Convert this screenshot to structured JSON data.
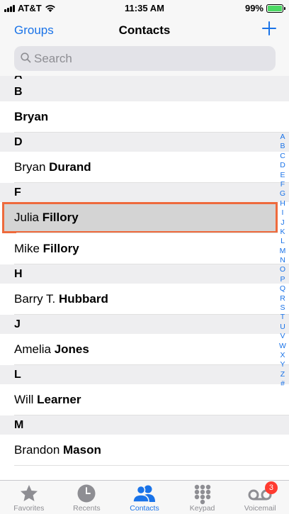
{
  "status": {
    "carrier": "AT&T",
    "time": "11:35 AM",
    "battery": "99%",
    "battery_level": 0.99
  },
  "nav": {
    "left": "Groups",
    "title": "Contacts"
  },
  "search": {
    "placeholder": "Search"
  },
  "sections": [
    {
      "letter": "A"
    },
    {
      "letter": "B",
      "contacts": [
        {
          "first": "",
          "last": "Bryan"
        }
      ]
    },
    {
      "letter": "D",
      "contacts": [
        {
          "first": "Bryan",
          "last": "Durand"
        }
      ]
    },
    {
      "letter": "F",
      "contacts": [
        {
          "first": "Julia",
          "last": "Fillory",
          "highlighted": true
        },
        {
          "first": "Mike",
          "last": "Fillory"
        }
      ]
    },
    {
      "letter": "H",
      "contacts": [
        {
          "first": "Barry T.",
          "last": "Hubbard"
        }
      ]
    },
    {
      "letter": "J",
      "contacts": [
        {
          "first": "Amelia",
          "last": "Jones"
        }
      ]
    },
    {
      "letter": "L",
      "contacts": [
        {
          "first": "Will",
          "last": "Learner"
        }
      ]
    },
    {
      "letter": "M",
      "contacts": [
        {
          "first": "Brandon",
          "last": "Mason"
        }
      ]
    }
  ],
  "index": [
    "A",
    "B",
    "C",
    "D",
    "E",
    "F",
    "G",
    "H",
    "I",
    "J",
    "K",
    "L",
    "M",
    "N",
    "O",
    "P",
    "Q",
    "R",
    "S",
    "T",
    "U",
    "V",
    "W",
    "X",
    "Y",
    "Z",
    "#"
  ],
  "tabs": [
    {
      "label": "Favorites",
      "icon": "star-icon"
    },
    {
      "label": "Recents",
      "icon": "clock-icon"
    },
    {
      "label": "Contacts",
      "icon": "people-icon",
      "active": true
    },
    {
      "label": "Keypad",
      "icon": "keypad-icon"
    },
    {
      "label": "Voicemail",
      "icon": "voicemail-icon",
      "badge": "3"
    }
  ],
  "colors": {
    "accent": "#1a73e8",
    "highlight_outline": "#ee6a3c",
    "battery": "#4cd964",
    "badge": "#ff3b30"
  }
}
